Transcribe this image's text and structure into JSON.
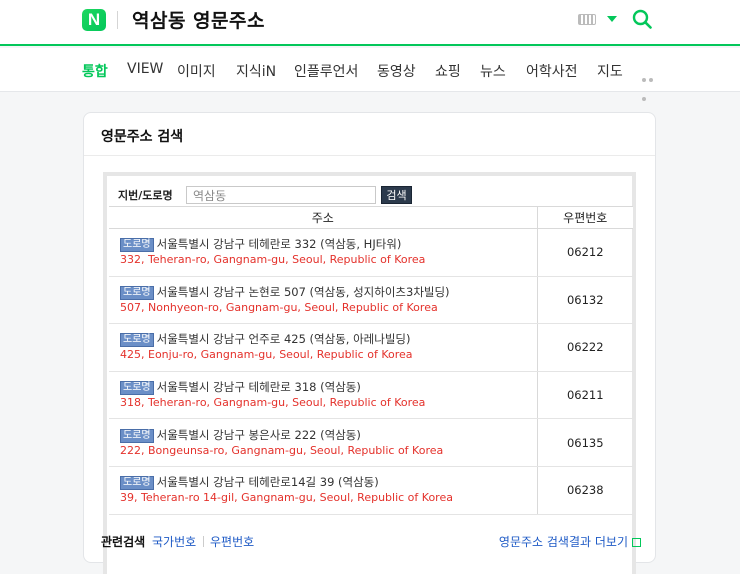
{
  "header": {
    "logo_letter": "N",
    "query": "역삼동 영문주소"
  },
  "tabs": [
    {
      "label": "통합",
      "active": true
    },
    {
      "label": "VIEW"
    },
    {
      "label": "이미지"
    },
    {
      "label": "지식iN"
    },
    {
      "label": "인플루언서"
    },
    {
      "label": "동영상"
    },
    {
      "label": "쇼핑"
    },
    {
      "label": "뉴스"
    },
    {
      "label": "어학사전"
    },
    {
      "label": "지도"
    }
  ],
  "card": {
    "title": "영문주소 검색",
    "search": {
      "label": "지번/도로명",
      "value": "역삼동",
      "button": "검색"
    },
    "columns": [
      "주소",
      "우편번호"
    ],
    "badge": "도로명",
    "rows": [
      {
        "kr": "서울특별시 강남구 테헤란로 332 (역삼동, HJ타워)",
        "en": "332, Teheran-ro, Gangnam-gu, Seoul, Republic of Korea",
        "zip": "06212"
      },
      {
        "kr": "서울특별시 강남구 논현로 507 (역삼동, 성지하이츠3차빌딩)",
        "en": "507, Nonhyeon-ro, Gangnam-gu, Seoul, Republic of Korea",
        "zip": "06132"
      },
      {
        "kr": "서울특별시 강남구 언주로 425 (역삼동, 아레나빌딩)",
        "en": "425, Eonju-ro, Gangnam-gu, Seoul, Republic of Korea",
        "zip": "06222"
      },
      {
        "kr": "서울특별시 강남구 테헤란로 318 (역삼동)",
        "en": "318, Teheran-ro, Gangnam-gu, Seoul, Republic of Korea",
        "zip": "06211"
      },
      {
        "kr": "서울특별시 강남구 봉은사로 222 (역삼동)",
        "en": "222, Bongeunsa-ro, Gangnam-gu, Seoul, Republic of Korea",
        "zip": "06135"
      },
      {
        "kr": "서울특별시 강남구 테헤란로14길 39 (역삼동)",
        "en": "39, Teheran-ro 14-gil, Gangnam-gu, Seoul, Republic of Korea",
        "zip": "06238"
      }
    ],
    "footer": {
      "label": "관련검색",
      "links": [
        "국가번호",
        "우편번호"
      ],
      "more": "영문주소 검색결과 더보기"
    }
  },
  "colors": {
    "brand": "#03c75a",
    "english_text": "#e4312b",
    "link": "#1f5bc6",
    "badge": "#6b8fc7"
  },
  "icons": {
    "keyboard": "keyboard-icon",
    "dropdown": "caret-down-icon",
    "search": "search-icon",
    "more": "more-dots-icon",
    "external": "external-link-icon"
  }
}
